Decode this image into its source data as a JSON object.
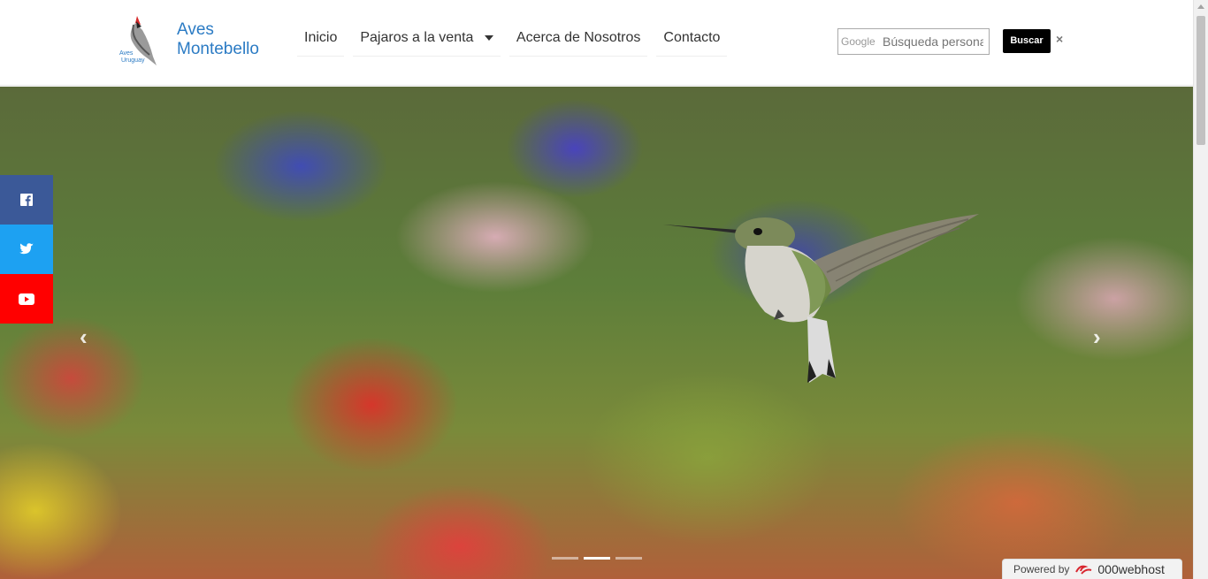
{
  "header": {
    "brand_line1": "Aves",
    "brand_line2": "Montebello",
    "logo_text_top": "Aves",
    "logo_text_bottom": "Uruguay"
  },
  "nav": {
    "items": [
      {
        "label": "Inicio"
      },
      {
        "label": "Pajaros a la venta"
      },
      {
        "label": "Acerca de Nosotros"
      },
      {
        "label": "Contacto"
      }
    ]
  },
  "search": {
    "brand": "Google",
    "placeholder": "Búsqueda personalizada",
    "button_label": "Buscar",
    "clear_label": "×"
  },
  "carousel": {
    "prev_label": "‹",
    "next_label": "›",
    "active_index": 1,
    "slide_count": 3
  },
  "social": {
    "items": [
      {
        "name": "facebook-icon",
        "color": "#3b5998"
      },
      {
        "name": "twitter-icon",
        "color": "#1da1f2"
      },
      {
        "name": "youtube-icon",
        "color": "#ff0000"
      }
    ]
  },
  "footer_badge": {
    "powered_label": "Powered by",
    "host_label": "000webhost"
  },
  "colors": {
    "brand": "#2b7bc4",
    "search_button": "#000000"
  }
}
